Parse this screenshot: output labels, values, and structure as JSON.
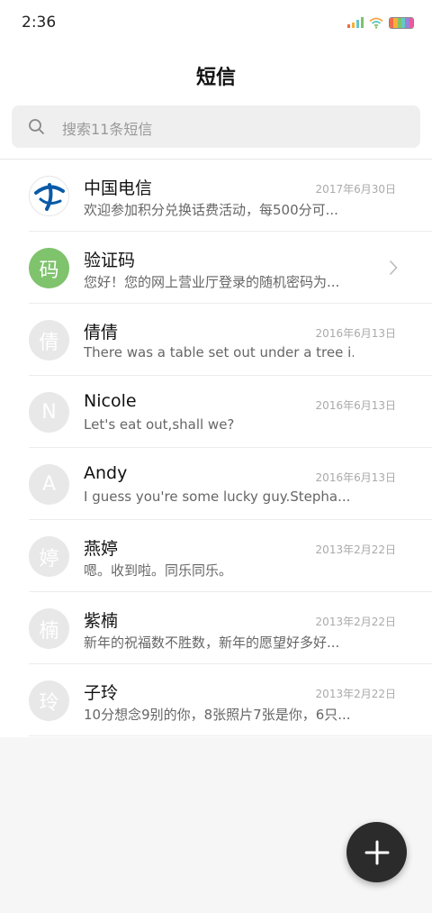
{
  "status_bar": {
    "time": "2:36"
  },
  "header": {
    "title": "短信"
  },
  "search": {
    "placeholder": "搜索11条短信"
  },
  "conversations": [
    {
      "name": "中国电信",
      "preview": "欢迎参加积分兑换话费活动，每500分可...",
      "date": "2017年6月30日",
      "avatar": "logo"
    },
    {
      "name": "验证码",
      "preview": "您好！您的网上营业厅登录的随机密码为...",
      "date": "",
      "avatar_text": "码"
    },
    {
      "name": "倩倩",
      "preview": "There was a table set out under a tree i...",
      "date": "2016年6月13日",
      "avatar_text": "倩"
    },
    {
      "name": "Nicole",
      "preview": "Let's eat out,shall we?",
      "date": "2016年6月13日",
      "avatar_text": "N"
    },
    {
      "name": "Andy",
      "preview": "I guess you're some lucky guy.Stepha...",
      "date": "2016年6月13日",
      "avatar_text": "A"
    },
    {
      "name": "燕婷",
      "preview": "嗯。收到啦。同乐同乐。",
      "date": "2013年2月22日",
      "avatar_text": "婷"
    },
    {
      "name": "紫楠",
      "preview": "新年的祝福数不胜数，新年的愿望好多好...",
      "date": "2013年2月22日",
      "avatar_text": "楠"
    },
    {
      "name": "子玲",
      "preview": "10分想念9别的你，8张照片7张是你，6只...",
      "date": "2013年2月22日",
      "avatar_text": "玲"
    }
  ],
  "colors": {
    "fab": "#2b2b2b",
    "verify_avatar": "#7fc36d",
    "default_avatar": "#e8e8e8",
    "telecom_logo": "#0a5aa8"
  },
  "icons": {
    "search": "search-icon",
    "chevron": "chevron-right-icon",
    "fab": "plus-icon",
    "wifi": "wifi-icon",
    "signal": "signal-icon",
    "battery": "battery-icon"
  }
}
